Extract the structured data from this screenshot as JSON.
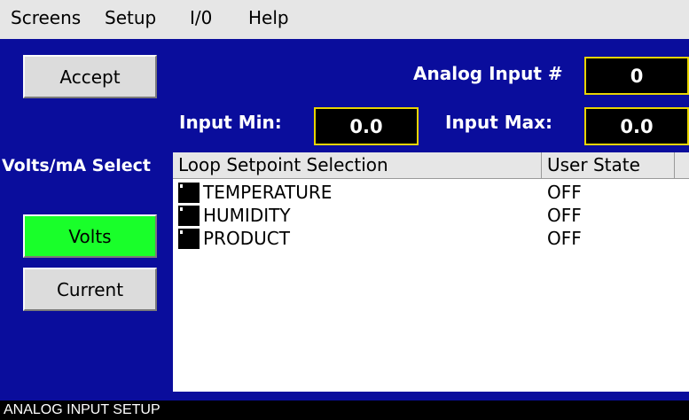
{
  "menu": [
    "Screens",
    "Setup",
    "I/0",
    "Help"
  ],
  "accept_label": "Accept",
  "analog_input": {
    "label": "Analog Input #",
    "value": "0"
  },
  "input_min": {
    "label": "Input Min:",
    "value": "0.0"
  },
  "input_max": {
    "label": "Input Max:",
    "value": "0.0"
  },
  "select_label": "Volts/mA Select",
  "volts_label": "Volts",
  "current_label": "Current",
  "table": {
    "headers": [
      "Loop Setpoint Selection",
      "User State"
    ],
    "rows": [
      {
        "name": "TEMPERATURE",
        "state": "OFF"
      },
      {
        "name": "HUMIDITY",
        "state": "OFF"
      },
      {
        "name": "PRODUCT",
        "state": "OFF"
      }
    ]
  },
  "status": "ANALOG INPUT SETUP",
  "colors": {
    "background": "#0a0d9c",
    "active_button": "#19ff2a",
    "value_border": "#e8d400"
  }
}
